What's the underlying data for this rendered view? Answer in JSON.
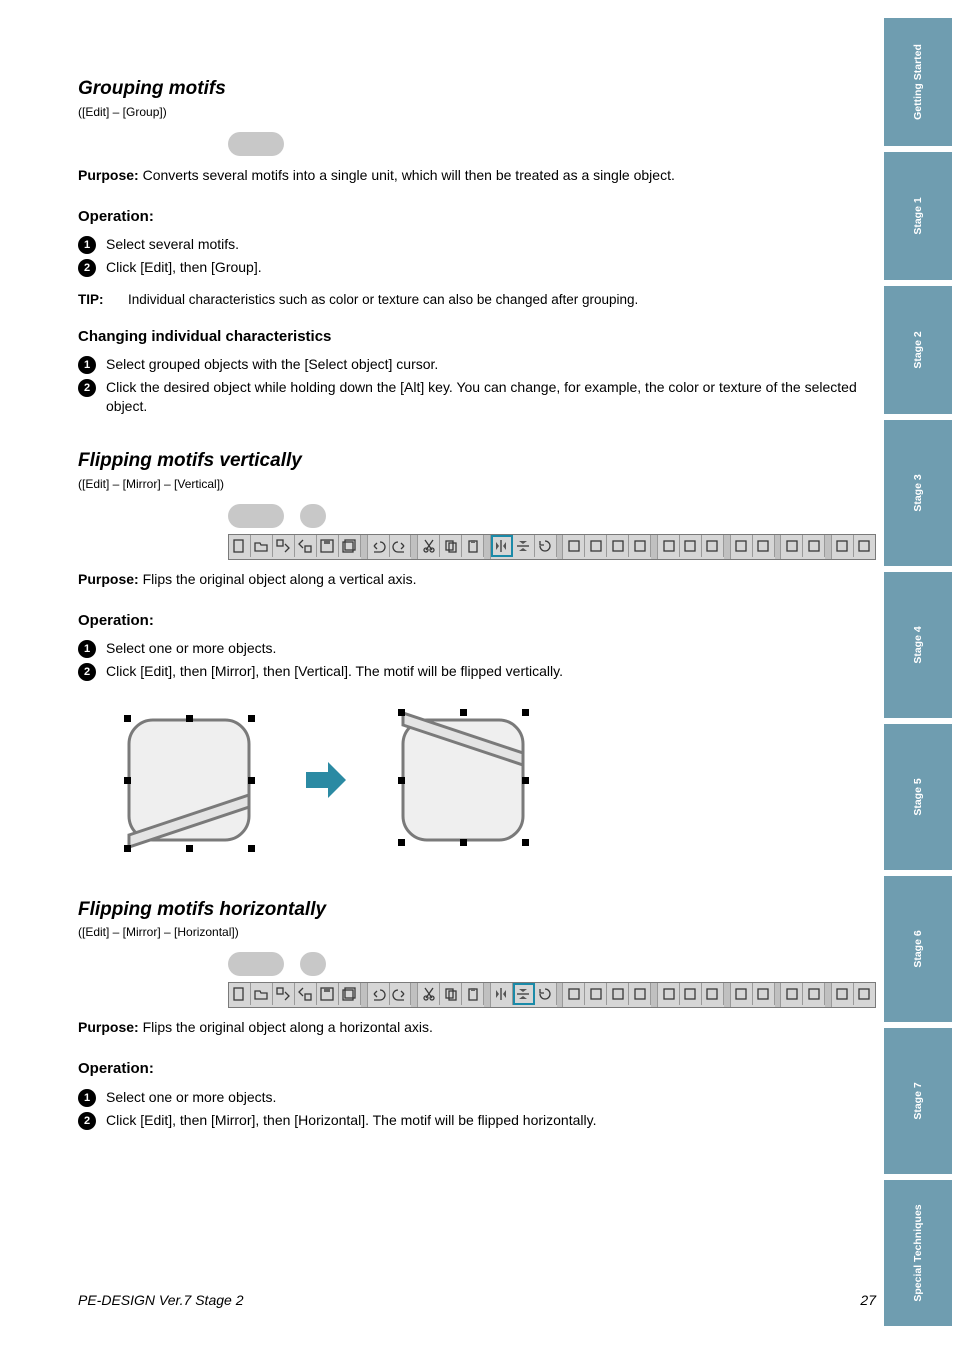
{
  "sections": {
    "group": {
      "title": "Grouping motifs",
      "sub": "([Edit] – [Group])",
      "desc_label": "Purpose:",
      "desc": "Converts several motifs into a single unit, which will then be treated as a single object.",
      "op_label": "Operation:",
      "steps": [
        "Select several motifs.",
        "Click [Edit], then [Group]."
      ],
      "tip_label": "TIP:",
      "tip": "Individual characteristics such as color or texture can also be changed after grouping.",
      "sub_title": "Changing individual characteristics",
      "sub_steps": [
        "Select grouped objects with the [Select object] cursor.",
        "Click the desired object while holding down the [Alt] key. You can change, for example, the color or texture of the selected object."
      ]
    },
    "vflip": {
      "title": "Flipping motifs vertically",
      "sub": "([Edit] – [Mirror] – [Vertical])",
      "desc_label": "Purpose:",
      "desc": "Flips the original object along a vertical axis.",
      "op_label": "Operation:",
      "steps": [
        "Select one or more objects.",
        "Click [Edit], then [Mirror], then [Vertical]. The motif will be flipped vertically."
      ]
    },
    "hflip": {
      "title": "Flipping motifs horizontally",
      "sub": "([Edit] – [Mirror] – [Horizontal])",
      "desc_label": "Purpose:",
      "desc": "Flips the original object along a horizontal axis.",
      "op_label": "Operation:",
      "steps": [
        "Select one or more objects.",
        "Click [Edit], then [Mirror], then [Horizontal]. The motif will be flipped horizontally."
      ]
    }
  },
  "tabs": [
    "Getting Started",
    "Stage 1",
    "Stage 2",
    "Stage 3",
    "Stage 4",
    "Stage 5",
    "Stage 6",
    "Stage 7",
    "Special Techniques"
  ],
  "tab_heights": [
    128,
    128,
    128,
    146,
    146,
    146,
    146,
    146,
    146
  ],
  "toolbar_icons": [
    "new",
    "open",
    "import",
    "export",
    "save",
    "save-all",
    "",
    "undo",
    "redo",
    "",
    "cut",
    "copy",
    "paste",
    "",
    "mirror-v",
    "mirror-h",
    "rotate",
    "",
    "align-l",
    "align-c",
    "align-r",
    "align-dist",
    "",
    "text1",
    "text2",
    "text3",
    "",
    "ruler1",
    "ruler2",
    "",
    "grid1",
    "grid2",
    "",
    "view",
    "zoom"
  ],
  "footer": {
    "left": "PE-DESIGN Ver.7 Stage 2",
    "right": "27"
  }
}
